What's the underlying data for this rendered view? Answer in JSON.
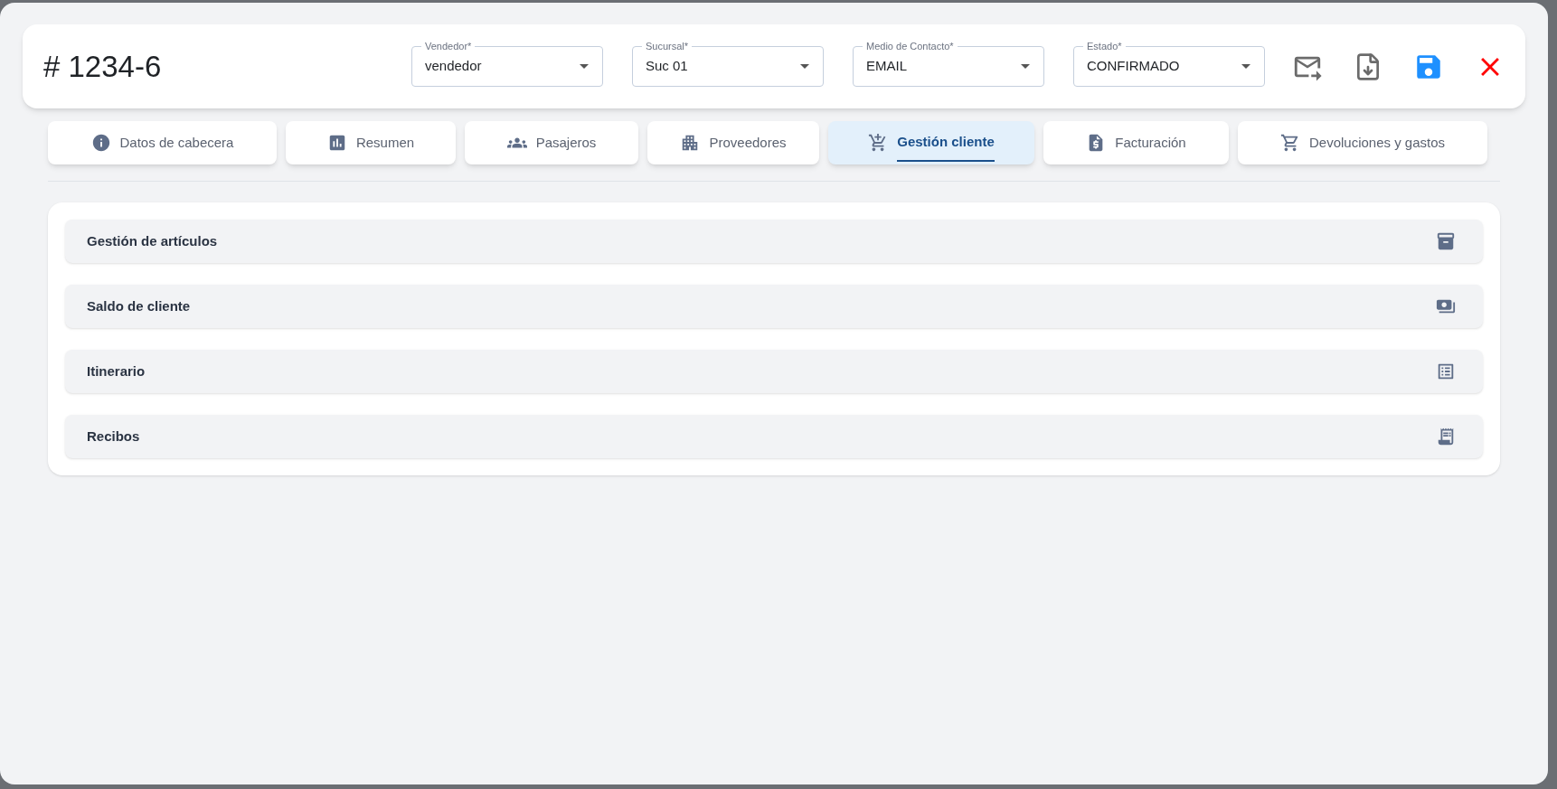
{
  "title": "# 1234-6",
  "fields": [
    {
      "label": "Vendedor*",
      "value": "vendedor"
    },
    {
      "label": "Sucursal*",
      "value": "Suc 01"
    },
    {
      "label": "Medio de Contacto*",
      "value": "EMAIL"
    },
    {
      "label": "Estado*",
      "value": "CONFIRMADO"
    }
  ],
  "tabs": [
    {
      "label": "Datos de cabecera",
      "selected": false
    },
    {
      "label": "Resumen",
      "selected": false
    },
    {
      "label": "Pasajeros",
      "selected": false
    },
    {
      "label": "Proveedores",
      "selected": false
    },
    {
      "label": "Gestión cliente",
      "selected": true
    },
    {
      "label": "Facturación",
      "selected": false
    },
    {
      "label": "Devoluciones y gastos",
      "selected": false
    }
  ],
  "sections": [
    {
      "title": "Gestión de artículos"
    },
    {
      "title": "Saldo de cliente"
    },
    {
      "title": "Itinerario"
    },
    {
      "title": "Recibos"
    }
  ]
}
